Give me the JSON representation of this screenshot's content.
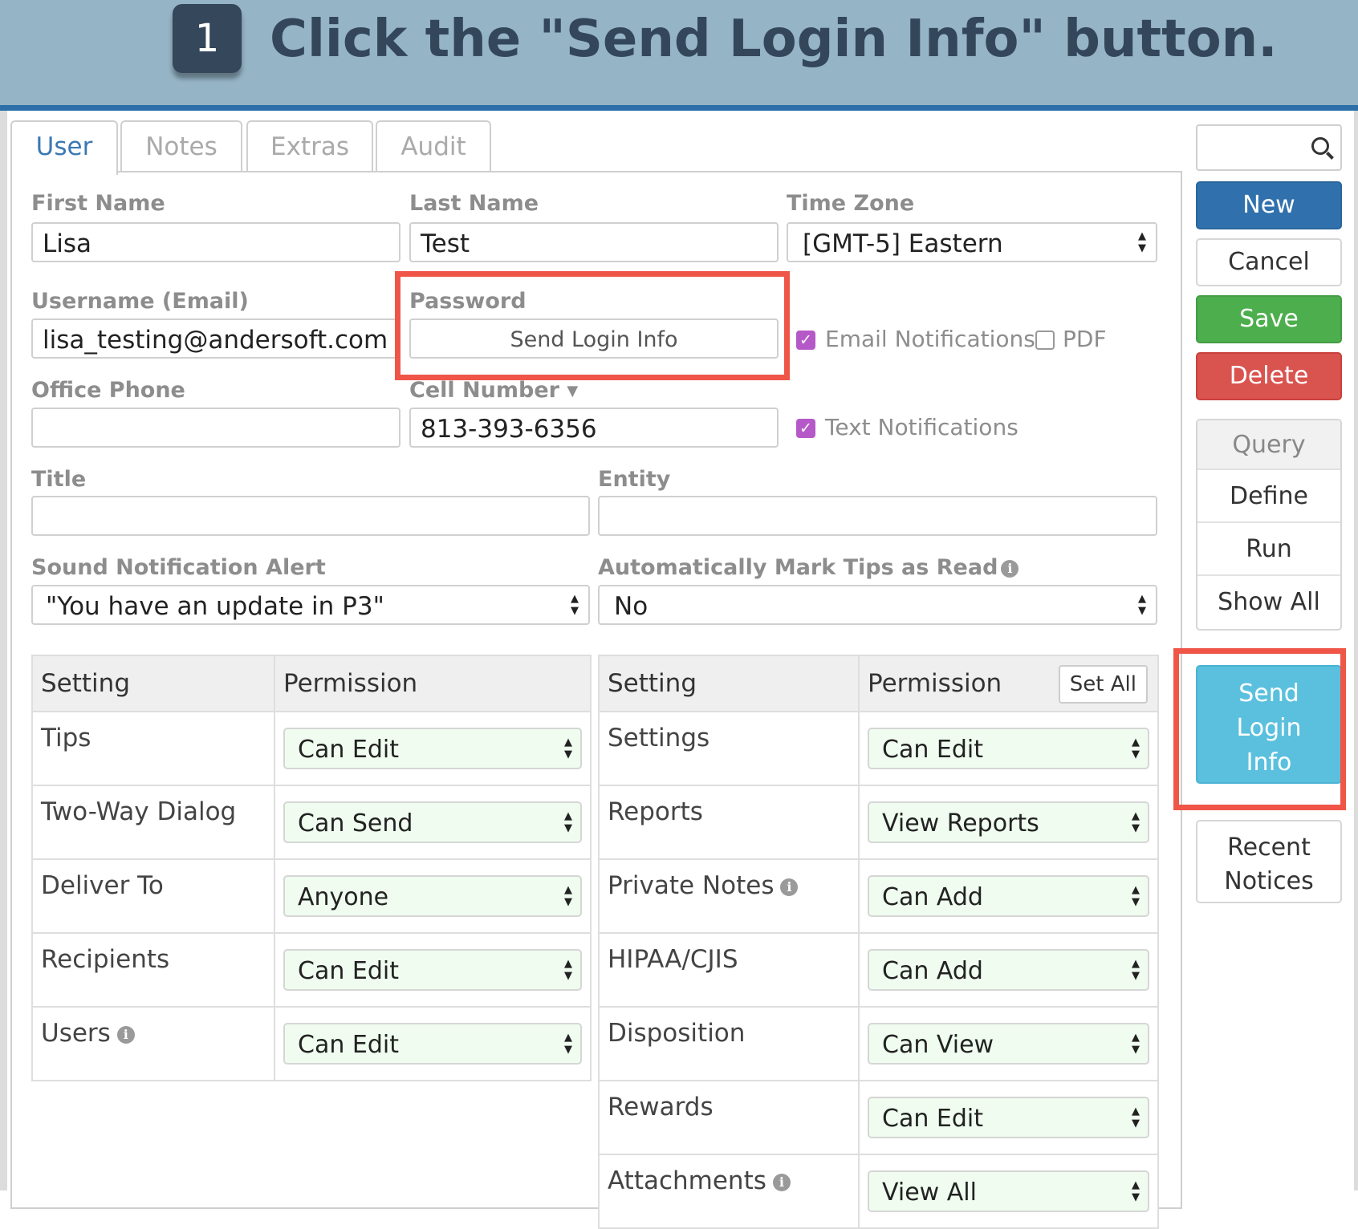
{
  "instruction": {
    "step_number": "1",
    "text": "Click the \"Send Login Info\" button."
  },
  "tabs": [
    {
      "label": "User",
      "active": true
    },
    {
      "label": "Notes"
    },
    {
      "label": "Extras"
    },
    {
      "label": "Audit"
    }
  ],
  "form": {
    "first_name": {
      "label": "First Name",
      "value": "Lisa"
    },
    "last_name": {
      "label": "Last Name",
      "value": "Test"
    },
    "time_zone": {
      "label": "Time Zone",
      "value": "[GMT-5] Eastern"
    },
    "username": {
      "label": "Username (Email)",
      "value": "lisa_testing@andersoft.com"
    },
    "password": {
      "label": "Password",
      "button_label": "Send Login Info"
    },
    "email_notifications": {
      "label": "Email Notifications",
      "checked": true
    },
    "pdf": {
      "label": "PDF",
      "checked": false
    },
    "office_phone": {
      "label": "Office Phone",
      "value": ""
    },
    "cell_number": {
      "label": "Cell Number",
      "value": "813-393-6356"
    },
    "text_notifications": {
      "label": "Text Notifications",
      "checked": true
    },
    "title": {
      "label": "Title",
      "value": ""
    },
    "entity": {
      "label": "Entity",
      "value": ""
    },
    "sound_alert": {
      "label": "Sound Notification Alert",
      "value": "\"You have an update in P3\""
    },
    "auto_mark_tips": {
      "label": "Automatically Mark Tips as Read",
      "value": "No"
    }
  },
  "icons": {
    "info": "info-icon",
    "search": "search-icon",
    "checkbox_check": "✓",
    "dropdown": "caret-down-icon"
  },
  "permissions_left": {
    "header_setting": "Setting",
    "header_permission": "Permission",
    "rows": [
      {
        "setting": "Tips",
        "permission": "Can Edit",
        "info": false
      },
      {
        "setting": "Two-Way Dialog",
        "permission": "Can Send",
        "info": false
      },
      {
        "setting": "Deliver To",
        "permission": "Anyone",
        "info": false
      },
      {
        "setting": "Recipients",
        "permission": "Can Edit",
        "info": false
      },
      {
        "setting": "Users",
        "permission": "Can Edit",
        "info": true
      }
    ]
  },
  "permissions_right": {
    "header_setting": "Setting",
    "header_permission": "Permission",
    "set_all_label": "Set All",
    "rows": [
      {
        "setting": "Settings",
        "permission": "Can Edit",
        "info": false
      },
      {
        "setting": "Reports",
        "permission": "View Reports",
        "info": false
      },
      {
        "setting": "Private Notes",
        "permission": "Can Add",
        "info": true
      },
      {
        "setting": "HIPAA/CJIS",
        "permission": "Can Add",
        "info": false
      },
      {
        "setting": "Disposition",
        "permission": "Can View",
        "info": false
      },
      {
        "setting": "Rewards",
        "permission": "Can Edit",
        "info": false
      },
      {
        "setting": "Attachments",
        "permission": "View All",
        "info": true
      }
    ]
  },
  "sidebar": {
    "search_value": "",
    "new_label": "New",
    "cancel_label": "Cancel",
    "save_label": "Save",
    "delete_label": "Delete",
    "query_group": [
      "Query",
      "Define",
      "Run",
      "Show All"
    ],
    "send_login_lines": [
      "Send",
      "Login",
      "Info"
    ],
    "recent_notices_lines": [
      "Recent",
      "Notices"
    ]
  },
  "colors": {
    "banner": "#95b4c6",
    "highlight": "#ef5648",
    "primary": "#3071ad",
    "success": "#4cae4c",
    "danger": "#d9534f",
    "info": "#5bc0de",
    "checkbox": "#b659c8"
  }
}
